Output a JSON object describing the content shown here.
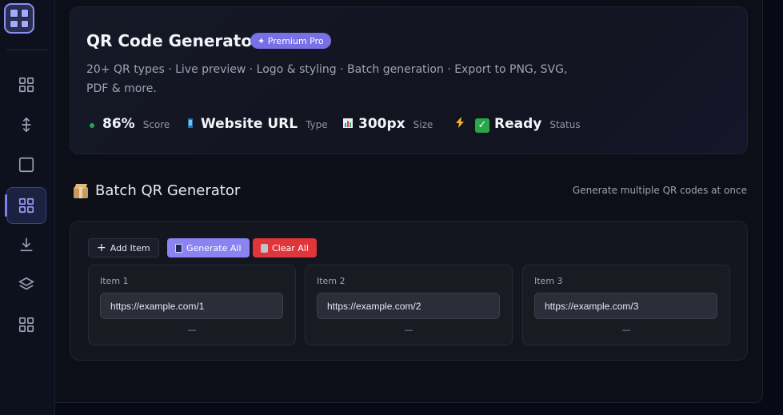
{
  "app": {
    "title": "QR Code Generator",
    "badge": "✦ Premium Pro",
    "description": "20+ QR types · Live preview · Logo & styling · Batch generation · Export to PNG, SVG, PDF & more."
  },
  "sidebar": {
    "items": [
      {
        "icon": "grid-icon"
      },
      {
        "icon": "move-vertical-icon"
      },
      {
        "icon": "square-icon"
      },
      {
        "icon": "grid-icon",
        "active": true
      },
      {
        "icon": "download-icon"
      },
      {
        "icon": "layers-icon"
      },
      {
        "icon": "grid-icon"
      }
    ]
  },
  "stats": [
    {
      "icon": "green-dot",
      "value": "86%",
      "label": "Score"
    },
    {
      "icon": "phone-icon",
      "value": "Website URL",
      "label": "Type"
    },
    {
      "icon": "bar-chart-icon",
      "value": "300px",
      "label": "Size"
    },
    {
      "icon": "lightning-icon",
      "value": "Ready",
      "label": "Status"
    }
  ],
  "batch": {
    "title": "Batch QR Generator",
    "subtitle": "Generate multiple QR codes at once",
    "add_label": "Add Item",
    "generate_label": "Generate All",
    "clear_label": "Clear All",
    "items": [
      {
        "label": "Item 1",
        "value": "https://example.com/1",
        "placeholder": "—"
      },
      {
        "label": "Item 2",
        "value": "https://example.com/2",
        "placeholder": "—"
      },
      {
        "label": "Item 3",
        "value": "https://example.com/3",
        "placeholder": "—"
      }
    ]
  },
  "colors": {
    "accent": "#8b83f2",
    "danger": "#e0353b",
    "success": "#2aa64a",
    "background": "#0d0f18"
  }
}
